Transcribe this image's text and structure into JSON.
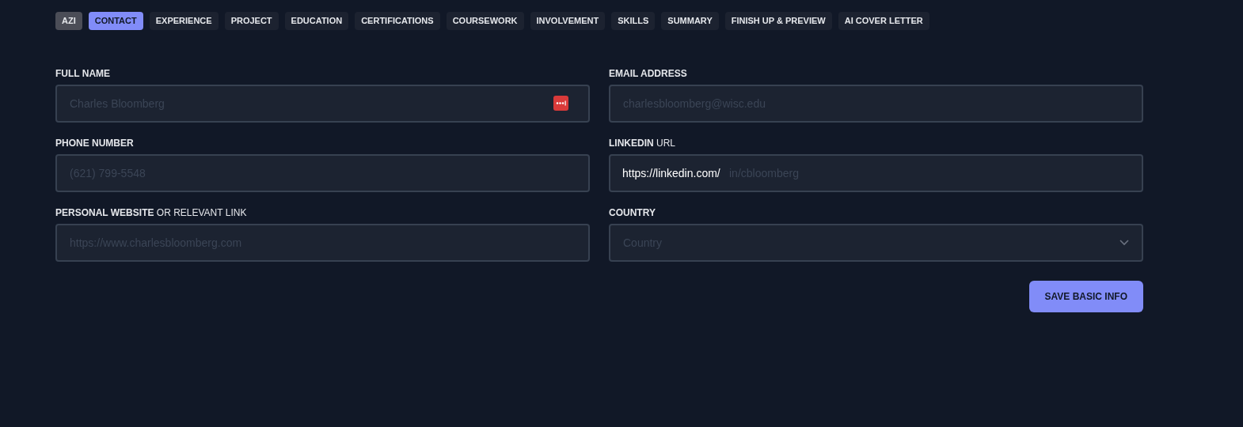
{
  "tabs": [
    {
      "label": "AZI",
      "kind": "badge",
      "selected": false
    },
    {
      "label": "CONTACT",
      "kind": "tab",
      "selected": true
    },
    {
      "label": "EXPERIENCE",
      "kind": "tab",
      "selected": false
    },
    {
      "label": "PROJECT",
      "kind": "tab",
      "selected": false
    },
    {
      "label": "EDUCATION",
      "kind": "tab",
      "selected": false
    },
    {
      "label": "CERTIFICATIONS",
      "kind": "tab",
      "selected": false
    },
    {
      "label": "COURSEWORK",
      "kind": "tab",
      "selected": false
    },
    {
      "label": "INVOLVEMENT",
      "kind": "tab",
      "selected": false
    },
    {
      "label": "SKILLS",
      "kind": "tab",
      "selected": false
    },
    {
      "label": "SUMMARY",
      "kind": "tab",
      "selected": false
    },
    {
      "label": "FINISH UP & PREVIEW",
      "kind": "tab",
      "selected": false
    },
    {
      "label": "AI COVER LETTER",
      "kind": "tab",
      "selected": false
    }
  ],
  "fields": [
    {
      "label": "**FULL NAME**",
      "kind": "text",
      "placeholder": "Charles Bloomberg",
      "password_manager_badge": true
    },
    {
      "label": "**EMAIL ADDRESS**",
      "kind": "text",
      "placeholder": "charlesbloomberg@wisc.edu"
    },
    {
      "label": "**PHONE NUMBER**",
      "kind": "text",
      "placeholder": "(621) 799-5548"
    },
    {
      "label": "**LINKEDIN** URL",
      "kind": "text",
      "prefix": "https://linkedin.com/",
      "placeholder": "in/cbloomberg"
    },
    {
      "label": "**PERSONAL WEBSITE** OR RELEVANT LINK",
      "kind": "text",
      "placeholder": "https://www.charlesbloomberg.com"
    },
    {
      "label": "**COUNTRY**",
      "kind": "select",
      "placeholder": "Country"
    }
  ],
  "save_button": "SAVE BASIC INFO"
}
